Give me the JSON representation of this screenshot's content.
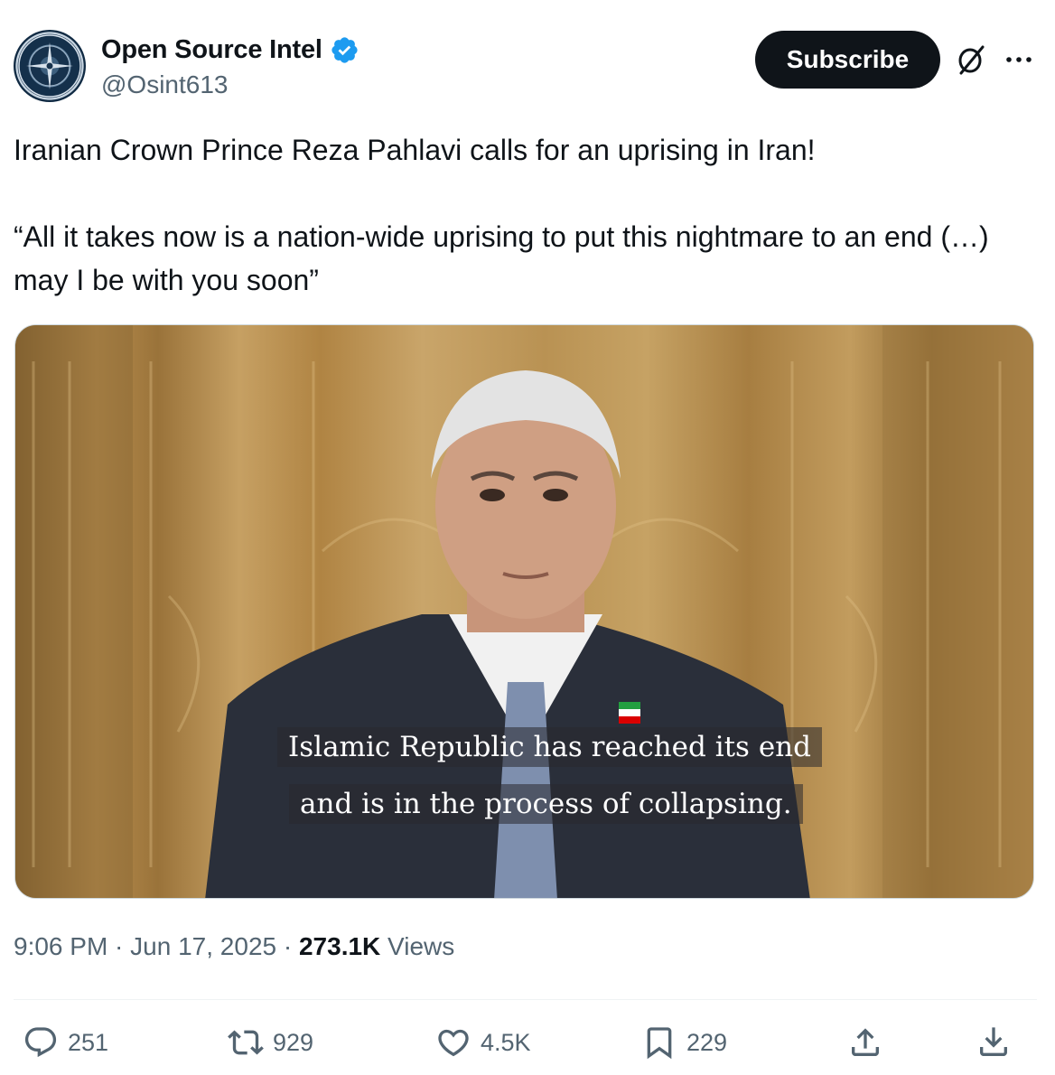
{
  "header": {
    "display_name": "Open Source Intel",
    "handle": "@Osint613",
    "subscribe_label": "Subscribe",
    "icons": [
      "avatar",
      "verified-badge-icon",
      "grok-icon",
      "more-icon"
    ],
    "verified_color": "#1d9bf0"
  },
  "tweet": {
    "line1": "Iranian Crown Prince  Reza Pahlavi calls for an uprising in Iran!",
    "line2": "“All it takes now is a nation-wide uprising to put this nightmare to an end (…) may I be with you soon”"
  },
  "media": {
    "caption_line1": "Islamic Republic has reached its end",
    "caption_line2": "and is in the process of collapsing."
  },
  "meta": {
    "time": "9:06 PM",
    "separator": " · ",
    "date": "Jun 17, 2025",
    "views_count": "273.1K",
    "views_label": " Views"
  },
  "actions": {
    "replies": "251",
    "reposts": "929",
    "likes": "4.5K",
    "bookmarks": "229",
    "icons": [
      "reply-icon",
      "repost-icon",
      "like-icon",
      "bookmark-icon",
      "share-icon",
      "download-icon"
    ]
  },
  "colors": {
    "text": "#0f1419",
    "secondary": "#536471",
    "button_bg": "#0f1419",
    "border": "#cfd9de"
  }
}
